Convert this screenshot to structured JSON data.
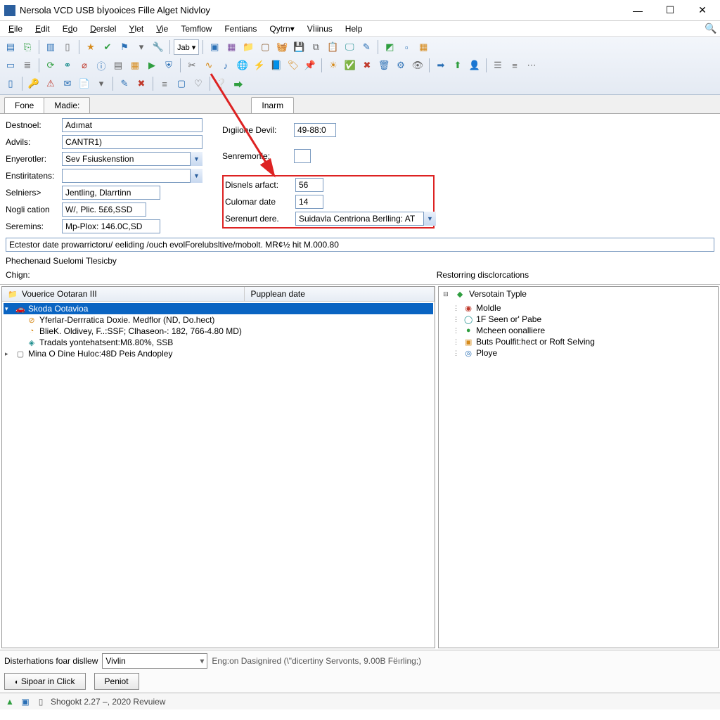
{
  "window": {
    "title": "Nersola  VCD  USB bİyooices Fille Alget  Nidvloy"
  },
  "menubar": {
    "items": [
      "Eile",
      "Edit",
      "Edo",
      "Derslel",
      "Ylet",
      "Vie",
      "Temflow",
      "Fentians",
      "Qytrn▾",
      "Vİiinus",
      "Help"
    ]
  },
  "tabs": {
    "left": [
      "Fone",
      "Madie:"
    ],
    "right": [
      "Inarm"
    ]
  },
  "form": {
    "left": {
      "destnool_label": "Destnoel:",
      "destnool_value": "Adımat",
      "advils_label": "Advils:",
      "advils_value": "CANTR1)",
      "enyerotler_label": "Enyerotler:",
      "enyerotler_value": "Sev Fsiuskenstion",
      "enstintatens_label": "Enstiritatens:",
      "enstintatens_value": "",
      "selniers_label": "Selniers>",
      "selniers_value": "Jentling, Dlarrtinn",
      "noglcation_label": "Nogli cation",
      "noglcation_value": "W/, Plic. 5£6,SSD",
      "seremins_label": "Seremins:",
      "seremins_value": "Mp-Plox: 146.0C,SD"
    },
    "right": {
      "digione_label": "Dıgiione Devil:",
      "digione_value": "49-88:0",
      "senremonle_label": "Senremonle:",
      "senremonle_value": "",
      "disnels_label": "Disnels arfact:",
      "disnels_value": "56",
      "culomar_label": "Culomar date",
      "culomar_value": "14",
      "serenurt_label": "Serenurt dere.",
      "serenurt_value": "Suidavla Centriona Berlling: AT"
    },
    "statusline": "Ectestor date prowarrictoru/ eeliding /ouch evolForelubsltive/mobolt. MR¢½ hit M.000.80",
    "section_label": "Phechenaıd Suelomi Tlesicby",
    "chign_label": "Chign:",
    "restoring_label": "Restorring disclorcations"
  },
  "left_tree": {
    "header_col1": "Vouerice Ootaran III",
    "header_col2": "Pupplean date",
    "rows": [
      {
        "text": "Skoda Ootavioa",
        "selected": true,
        "indent": 0,
        "twisty": "▾"
      },
      {
        "text": "Yferlar-Derrratica Doxie. Medflor (ND, Do.hect)",
        "indent": 1
      },
      {
        "text": "BlieK. Oldivey, F..:SSF; Clhaseon-: 182, 766-4.80 MD)",
        "indent": 1
      },
      {
        "text": "Tradals yontehatsent:Mß.80%, SSB",
        "indent": 1
      },
      {
        "text": "Mina O Dine Huloc:48D Peis Andopley",
        "indent": 0
      }
    ]
  },
  "right_tree": {
    "header": "Versotain Typle",
    "rows": [
      "Moldle",
      "1F Seen or' Pabe",
      "Mcheen oonalliere",
      "Buts Poulfit:hect or Roft Selving",
      "Ploye"
    ]
  },
  "bottom": {
    "label": "Disterhations foar disllew",
    "combo_value": "Vivlin",
    "hint": "Eng:on Dasignired (\\\"dicertiny Servonts, 9.00B Fëırling;)",
    "button1": "Sipoar in Click",
    "button2": "Peniot"
  },
  "statusbar": {
    "text": "Shogokt 2.27 –,  2020 Revuiew"
  }
}
